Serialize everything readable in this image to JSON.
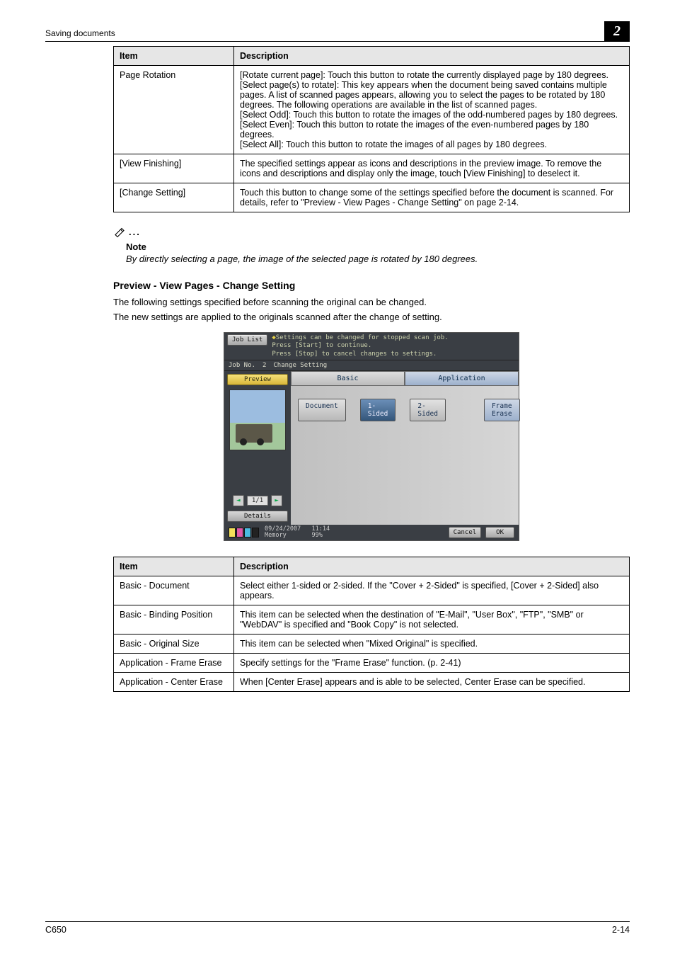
{
  "header": {
    "breadcrumb": "Saving documents",
    "chapter_badge": "2"
  },
  "table1": {
    "headers": {
      "item": "Item",
      "desc": "Description"
    },
    "rows": [
      {
        "item": "Page Rotation",
        "desc": "[Rotate current page]: Touch this button to rotate the currently displayed page by 180 degrees.\n[Select page(s) to rotate]: This key appears when the document being saved contains multiple pages. A list of scanned pages appears, allowing you to select the pages to be rotated by 180 degrees. The following operations are available in the list of scanned pages.\n[Select Odd]: Touch this button to rotate the images of the odd-numbered pages by 180 degrees.\n[Select Even]: Touch this button to rotate the images of the even-numbered pages by 180 degrees.\n[Select All]: Touch this button to rotate the images of all pages by 180 degrees."
      },
      {
        "item": "[View Finishing]",
        "desc": "The specified settings appear as icons and descriptions in the preview image. To remove the icons and descriptions and display only the image, touch [View Finishing] to deselect it."
      },
      {
        "item": "[Change Setting]",
        "desc": "Touch this button to change some of the settings specified before the document is scanned. For details, refer to \"Preview - View Pages - Change Setting\" on page 2-14."
      }
    ]
  },
  "note": {
    "label": "Note",
    "text": "By directly selecting a page, the image of the selected page is rotated by 180 degrees."
  },
  "section": {
    "heading": "Preview - View Pages - Change Setting",
    "p1": "The following settings specified before scanning the original can be changed.",
    "p2": "The new settings are applied to the originals scanned after the change of setting."
  },
  "screen": {
    "job_list": "Job List",
    "msg_l1": "Settings can be changed for stopped scan job.",
    "msg_l2": "Press [Start] to continue.",
    "msg_l3": "Press [Stop] to cancel changes to settings.",
    "job_no_label": "Job No.",
    "job_no_value": "2",
    "job_title": "Change Setting",
    "tab_basic": "Basic",
    "tab_application": "Application",
    "preview": "Preview",
    "btn_document": "Document",
    "btn_1sided": "1-Sided",
    "btn_2sided": "2-Sided",
    "btn_frame_erase": "Frame Erase",
    "pager_page": "1/",
    "pager_total": "1",
    "details": "Details",
    "date": "09/24/2007",
    "time": "11:14",
    "mem_label": "Memory",
    "mem_value": "99%",
    "cancel": "Cancel",
    "ok": "OK"
  },
  "table2": {
    "headers": {
      "item": "Item",
      "desc": "Description"
    },
    "rows": [
      {
        "item": "Basic - Document",
        "desc": "Select either 1-sided or 2-sided. If the \"Cover + 2-Sided\" is specified, [Cover + 2-Sided] also appears."
      },
      {
        "item": "Basic - Binding Position",
        "desc": "This item can be selected when the destination of \"E-Mail\", \"User Box\", \"FTP\", \"SMB\" or \"WebDAV\" is specified and \"Book Copy\" is not selected."
      },
      {
        "item": "Basic - Original Size",
        "desc": "This item can be selected when \"Mixed Original\" is specified."
      },
      {
        "item": "Application - Frame Erase",
        "desc": "Specify settings for the \"Frame Erase\" function. (p. 2-41)"
      },
      {
        "item": "Application - Center Erase",
        "desc": "When [Center Erase] appears and is able to be selected, Center Erase can be specified."
      }
    ]
  },
  "footer": {
    "model": "C650",
    "page": "2-14"
  }
}
